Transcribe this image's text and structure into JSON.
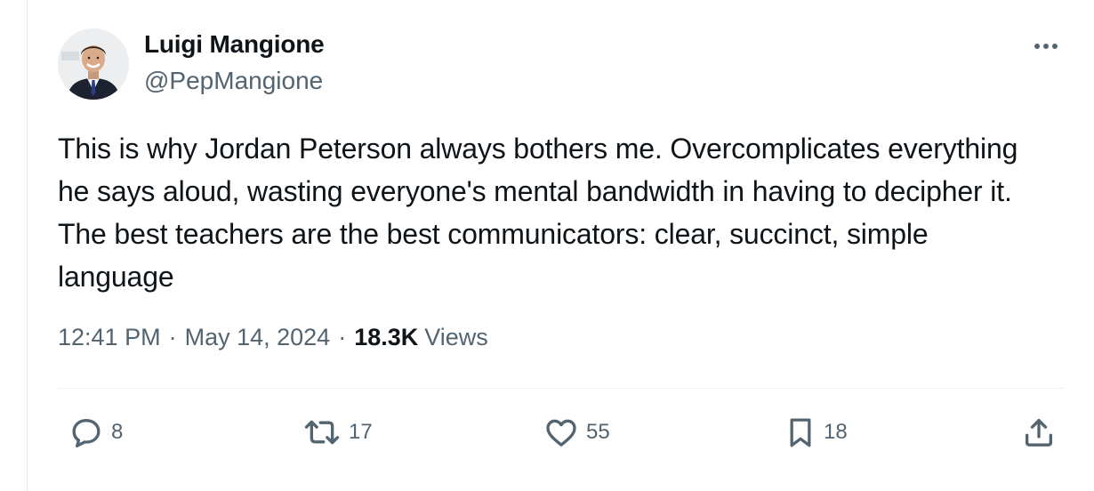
{
  "author": {
    "name": "Luigi Mangione",
    "handle": "@PepMangione"
  },
  "tweet": {
    "text": "This is why Jordan Peterson always bothers me. Overcomplicates everything he says aloud, wasting everyone's mental bandwidth in having to decipher it. The best teachers are the best communicators: clear, succinct, simple language"
  },
  "meta": {
    "time": "12:41 PM",
    "separator": "·",
    "date": "May 14, 2024",
    "views_count": "18.3K",
    "views_label": "Views"
  },
  "actions": {
    "replies": "8",
    "retweets": "17",
    "likes": "55",
    "bookmarks": "18"
  },
  "icons": {
    "more": "more-horizontal-icon",
    "reply": "reply-icon",
    "retweet": "retweet-icon",
    "like": "heart-icon",
    "bookmark": "bookmark-icon",
    "share": "share-icon"
  },
  "colors": {
    "text_primary": "#0f1419",
    "text_secondary": "#536471",
    "divider": "#eff3f4"
  }
}
